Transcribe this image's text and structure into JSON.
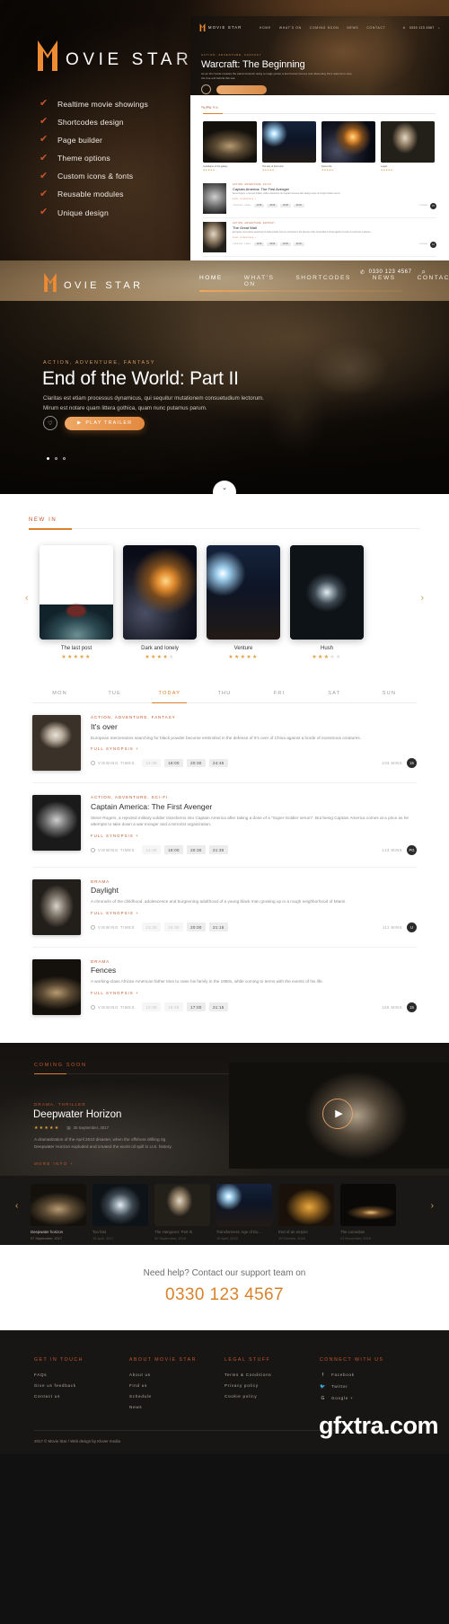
{
  "brand": {
    "name_m": "M",
    "name_rest": "OVIE  STAR",
    "logo_color": "#ef8b32"
  },
  "promo": {
    "features": [
      "Realtime movie showings",
      "Shortcodes design",
      "Page builder",
      "Theme options",
      "Custom icons & fonts",
      "Reusable modules",
      "Unique design"
    ],
    "check_icon": "check-icon"
  },
  "mock": {
    "logo": "MOVIE STAR",
    "menu": [
      "HOME",
      "WHAT'S ON",
      "COMING SOON",
      "NEWS",
      "CONTACT"
    ],
    "phone": "0330 123 4567",
    "category": "ACTION, ADVENTURE, FANTASY",
    "title": "Warcraft: The Beginning",
    "desc": "As an Orc horde invades the planet Azeroth using a magic portal, a few human heroes and dissenting Orcs attempt to stop the true evil behind this war.",
    "play_label": "PLAY TRAILER",
    "section_label": "NEW IN",
    "cards": [
      {
        "title": "Guardians of the galaxy",
        "stars": "★★★★★"
      },
      {
        "title": "The last of their kind",
        "stars": "★★★★★"
      },
      {
        "title": "Secret life",
        "stars": "★★★★★"
      },
      {
        "title": "Logan",
        "stars": "★★★★★"
      }
    ],
    "rows": [
      {
        "category": "ACTION, ADVENTURE, SCI-FI",
        "title": "Captain America: The First Avenger",
        "desc": "Steve Rogers, a rejected military soldier transforms into Captain America after taking a dose of a Super-Soldier serum.",
        "link": "FULL SYNOPSIS +",
        "times_label": "VIEWING TIMES",
        "times": [
          "14:45",
          "18:00",
          "20:30",
          "24:45"
        ],
        "mins": "123 MINS",
        "rating": "15"
      },
      {
        "category": "ACTION, ADVENTURE, FANTASY",
        "title": "The Great Wall",
        "desc": "European mercenaries searching for black powder become embroiled in the defense of the Great Wall of China against a horde of monstrous creatures.",
        "link": "FULL SYNOPSIS +",
        "times_label": "VIEWING TIMES",
        "times": [
          "14:45",
          "18:00",
          "20:30",
          "24:45"
        ],
        "mins": "103 MINS",
        "rating": "12"
      }
    ]
  },
  "nav": {
    "items": [
      {
        "label": "HOME",
        "active": true
      },
      {
        "label": "WHAT'S ON",
        "active": false
      },
      {
        "label": "SHORTCODES",
        "active": false
      },
      {
        "label": "NEWS",
        "active": false
      },
      {
        "label": "CONTACT",
        "active": false
      }
    ],
    "phone": "0330 123 4567",
    "phone_icon": "phone-icon",
    "search_icon": "search-icon"
  },
  "hero": {
    "category": "ACTION, ADVENTURE, FANTASY",
    "title": "End of the World: Part II",
    "description": "Claritas est etiam processus dynamicus, qui sequitur mutationem consuetudium lectorum. Mirum est notare quam littera gothica, quam nunc putamus parum.",
    "info_icon": "info-icon",
    "play_label": "PLAY TRAILER",
    "play_icon": "play-icon",
    "dots": 3,
    "active_dot": 0,
    "scroll_icon": "chevron-down-icon"
  },
  "newin": {
    "label": "NEW IN",
    "prev_icon": "chevron-left-icon",
    "next_icon": "chevron-right-icon",
    "cards": [
      {
        "title": "The last post",
        "rating": 5,
        "art": "art-scream"
      },
      {
        "title": "Dark and lonely",
        "rating": 4,
        "art": "art-comet"
      },
      {
        "title": "Venture",
        "rating": 5,
        "art": "art-city"
      },
      {
        "title": "Hush",
        "rating": 3,
        "art": "art-tunnel"
      }
    ]
  },
  "schedule": {
    "days": [
      {
        "label": "MON",
        "active": false
      },
      {
        "label": "TUE",
        "active": false
      },
      {
        "label": "TODAY",
        "active": true
      },
      {
        "label": "THU",
        "active": false
      },
      {
        "label": "FRI",
        "active": false
      },
      {
        "label": "SAT",
        "active": false
      },
      {
        "label": "SUN",
        "active": false
      }
    ],
    "times_label": "VIEWING TIMES",
    "synopsis_label": "FULL SYNOPSIS +",
    "shows": [
      {
        "category": "ACTION, ADVENTURE, FANTASY",
        "title": "It's over",
        "desc": "European mercenaries searching for black powder become embroiled in the defense of It's over of China against a horde of monstrous creatures.",
        "times": [
          {
            "t": "14:45",
            "dim": true
          },
          {
            "t": "18:00",
            "dim": false
          },
          {
            "t": "20:30",
            "dim": false
          },
          {
            "t": "24:45",
            "dim": false
          }
        ],
        "mins": "103 MINS",
        "rating": "15",
        "art": "art-clown"
      },
      {
        "category": "ACTION, ADVENTURE, SCI-FI",
        "title": "Captain America: The First Avenger",
        "desc": "Steve Rogers, a rejected military soldier transforms into Captain America after taking a dose of a \"Super-Soldier serum\". But being Captain America comes at a price as he attempts to take down a war monger and a terrorist organization.",
        "times": [
          {
            "t": "14:45",
            "dim": true
          },
          {
            "t": "18:00",
            "dim": false
          },
          {
            "t": "20:30",
            "dim": false
          },
          {
            "t": "21:30",
            "dim": false
          }
        ],
        "mins": "123 MINS",
        "rating": "PG",
        "art": "art-hands"
      },
      {
        "category": "DRAMA",
        "title": "Daylight",
        "desc": "A chronicle of the childhood, adolescence and burgeoning adulthood of a young black man growing up in a rough neighborhood of Miami.",
        "times": [
          {
            "t": "13:30",
            "dim": true
          },
          {
            "t": "16:30",
            "dim": true
          },
          {
            "t": "20:00",
            "dim": false
          },
          {
            "t": "21:15",
            "dim": false
          }
        ],
        "mins": "111 MINS",
        "rating": "U",
        "art": "art-face"
      },
      {
        "category": "DRAMA",
        "title": "Fences",
        "desc": "A working-class African-American father tries to raise his family in the 1950s, while coming to terms with the events of his life.",
        "times": [
          {
            "t": "12:45",
            "dim": true
          },
          {
            "t": "15:45",
            "dim": true
          },
          {
            "t": "17:00",
            "dim": false
          },
          {
            "t": "21:15",
            "dim": false
          }
        ],
        "mins": "165 MINS",
        "rating": "15",
        "art": "art-war"
      }
    ]
  },
  "coming": {
    "label": "COMING SOON",
    "category": "DRAMA, THRILLER",
    "title": "Deepwater Horizon",
    "stars": "★★★★★",
    "date": "30 September, 2017",
    "date_icon": "calendar-icon",
    "description": "A dramatization of the April 2010 disaster, when the offshore drilling rig Deepwater Horizon exploded and created the worst oil spill in U.S. history.",
    "more_label": "MORE INFO +",
    "play_icon": "play-icon",
    "prev_icon": "chevron-left-icon",
    "next_icon": "chevron-right-icon",
    "strip": [
      {
        "title": "Deepwater horizon",
        "date": "07 September, 2017",
        "active": true,
        "art": "art-war"
      },
      {
        "title": "Too fast",
        "date": "15 April, 2017",
        "active": false,
        "art": "art-tunnel"
      },
      {
        "title": "The Hangover: Part III",
        "date": "30 September, 2018",
        "active": false,
        "art": "art-wall"
      },
      {
        "title": "Transformers: Age of Ex...",
        "date": "15 April, 2018",
        "active": false,
        "art": "art-city"
      },
      {
        "title": "End of an empire",
        "date": "19 October, 2018",
        "active": false,
        "art": "art-comet"
      },
      {
        "title": "The comedian",
        "date": "21 November, 2018",
        "active": false,
        "art": "art-face"
      }
    ]
  },
  "support": {
    "question": "Need help? Contact our support team on",
    "number": "0330 123 4567"
  },
  "footer": {
    "columns": [
      {
        "heading": "GET IN TOUCH",
        "items": [
          "FAQs",
          "Give us feedback",
          "Contact us"
        ]
      },
      {
        "heading": "ABOUT MOVIE STAR",
        "items": [
          "About us",
          "Find us",
          "Schedule",
          "News"
        ]
      },
      {
        "heading": "LEGAL STUFF",
        "items": [
          "Terms & Conditions",
          "Privacy policy",
          "Cookie policy"
        ]
      }
    ],
    "social_heading": "CONNECT WITH US",
    "social": [
      {
        "icon": "facebook-icon",
        "glyph": "f",
        "label": "Facebook"
      },
      {
        "icon": "twitter-icon",
        "glyph": "ᵛ",
        "label": "Twitter"
      },
      {
        "icon": "google-plus-icon",
        "glyph": "G",
        "label": "Google +"
      }
    ],
    "copyright": "2017 © Movie Star / Web design by Klover media",
    "watermark": "gfxtra.com"
  }
}
